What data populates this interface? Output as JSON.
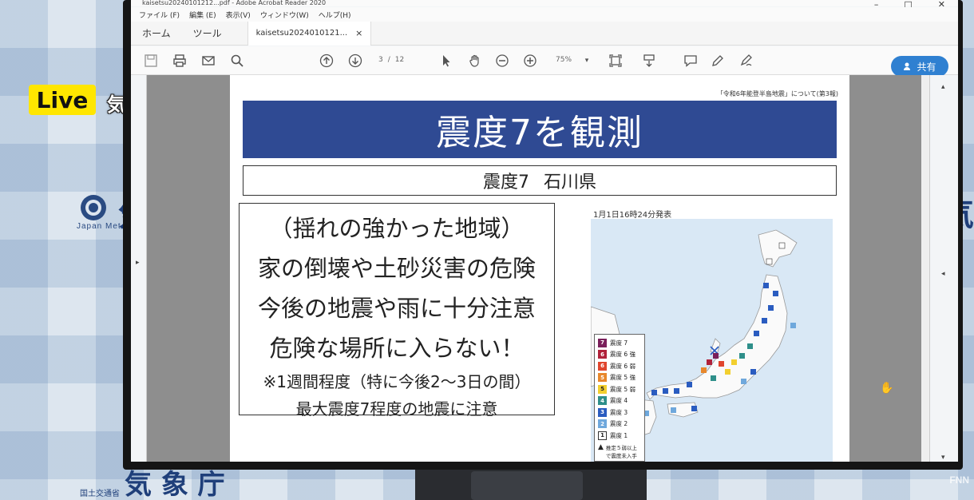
{
  "overlay": {
    "live_label": "Live",
    "agency": "気象庁"
  },
  "background": {
    "logo_text_small": "Japan Mete",
    "logo_big": "気",
    "right_big": "気",
    "bottom_small": "国土交通省",
    "bottom_big": "気 象 庁",
    "watermark": "FNN"
  },
  "window": {
    "title": "kaisetsu20240101212...pdf - Adobe Acrobat Reader 2020",
    "menu": [
      "ファイル (F)",
      "編集 (E)",
      "表示(V)",
      "ウィンドウ(W)",
      "ヘルプ(H)"
    ]
  },
  "tabs": {
    "home": "ホーム",
    "tools": "ツール",
    "document": "kaisetsu20240101​21...",
    "close": "×"
  },
  "toolbar": {
    "page_current": "3",
    "page_sep": "/",
    "page_total": "12",
    "zoom": "75%",
    "share_label": "共有"
  },
  "document": {
    "header_note": "「令和6年能登半島地震」について(第3報)",
    "banner_title": "震度7を観測",
    "sub_intensity": "震度7",
    "sub_region": "石川県",
    "main_lines": [
      "（揺れの強かった地域）",
      "家の倒壊や土砂災害の危険",
      "今後の地震や雨に十分注意",
      "危険な場所に入らない！"
    ],
    "note_lines": [
      "※1週間程度（特に今後2～3日の間）",
      "最大震度7程度の地震に注意"
    ],
    "map_caption": "1月1日16時24分発表"
  },
  "legend": {
    "items": [
      {
        "mark": "7",
        "label": "震度 7",
        "color": "#7a1f5a"
      },
      {
        "mark": "6",
        "label": "震度 6 強",
        "color": "#b0213a"
      },
      {
        "mark": "6",
        "label": "震度 6 弱",
        "color": "#e0452d"
      },
      {
        "mark": "5",
        "label": "震度 5 強",
        "color": "#e8872c"
      },
      {
        "mark": "5",
        "label": "震度 5 弱",
        "color": "#f2cf2f"
      },
      {
        "mark": "4",
        "label": "震度 4",
        "color": "#2e8f8a"
      },
      {
        "mark": "3",
        "label": "震度 3",
        "color": "#2a5cc0"
      },
      {
        "mark": "2",
        "label": "震度 2",
        "color": "#6fa8dc"
      },
      {
        "mark": "1",
        "label": "震度 1",
        "color": "#ffffff"
      }
    ],
    "note": "推定５弱以上で震度未入手"
  }
}
